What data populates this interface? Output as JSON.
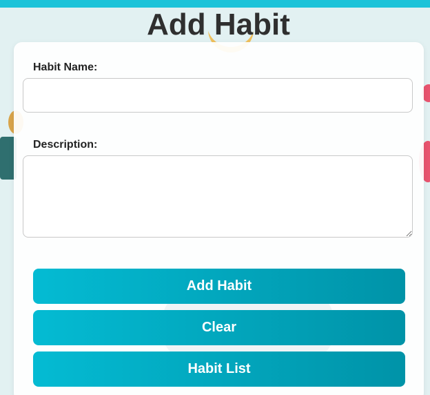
{
  "header": {
    "title": "Add Habit"
  },
  "form": {
    "habit_name_label": "Habit Name:",
    "habit_name_value": "",
    "description_label": "Description:",
    "description_value": ""
  },
  "buttons": {
    "add_label": "Add Habit",
    "clear_label": "Clear",
    "list_label": "Habit List"
  },
  "colors": {
    "accent": "#1cc3d9",
    "button_gradient_start": "#04bbd3",
    "button_gradient_end": "#0093a8",
    "background": "#e2f1f2"
  }
}
